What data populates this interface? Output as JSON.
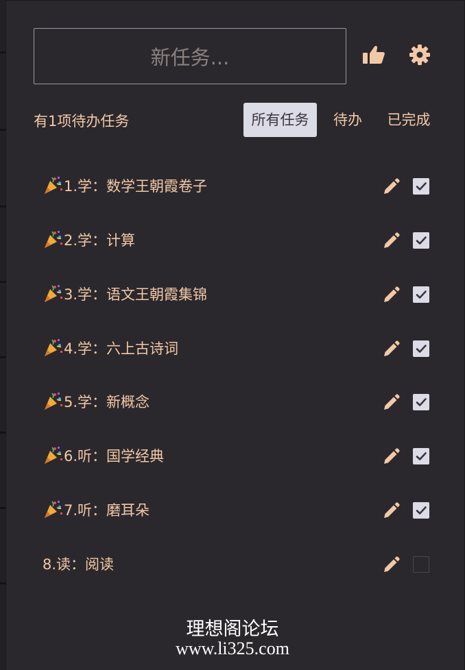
{
  "new_task": {
    "placeholder": "新任务..."
  },
  "header_icons": {
    "thumb": "thumbs-up-icon",
    "settings": "gear-icon"
  },
  "summary": {
    "text": "有1项待办任务"
  },
  "filters": [
    {
      "label": "所有任务",
      "active": true
    },
    {
      "label": "待办",
      "active": false
    },
    {
      "label": "已完成",
      "active": false
    }
  ],
  "tasks": [
    {
      "text": "1.学：数学王朝霞卷子",
      "done": true
    },
    {
      "text": "2.学：计算",
      "done": true
    },
    {
      "text": "3.学：语文王朝霞集锦",
      "done": true
    },
    {
      "text": "4.学：六上古诗词",
      "done": true
    },
    {
      "text": "5.学：新概念",
      "done": true
    },
    {
      "text": "6.听：国学经典",
      "done": true
    },
    {
      "text": "7.听：磨耳朵",
      "done": true
    },
    {
      "text": "8.读：阅读",
      "done": false
    }
  ],
  "footer": {
    "line1": "理想阁论坛",
    "line2": "www.li325.com"
  },
  "colors": {
    "background": "#2b282d",
    "text": "#f2c9a6",
    "active_tab": "#dcdce6",
    "input_border": "#9a96a4"
  }
}
